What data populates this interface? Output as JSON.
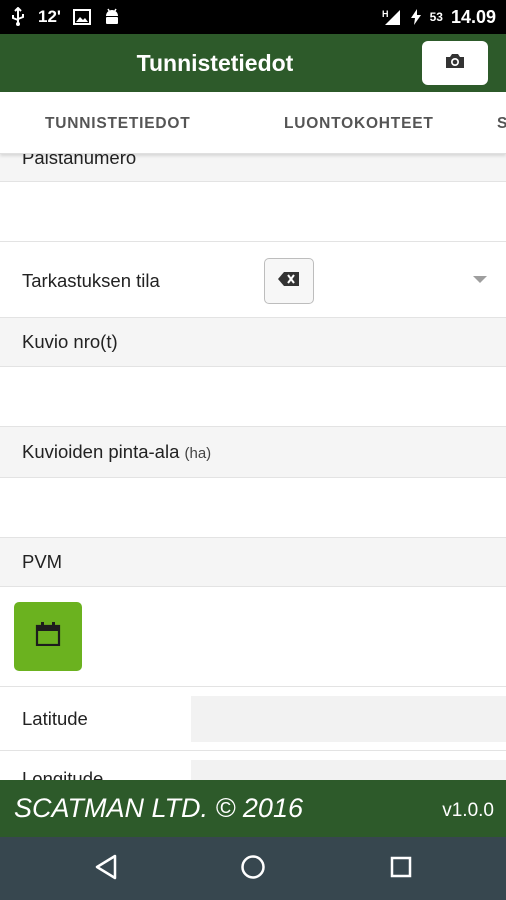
{
  "status_bar": {
    "usb_icon": "usb-icon",
    "temperature": "12'",
    "image_icon": "image-icon",
    "android_icon": "android-icon",
    "signal_label": "H",
    "battery": "53",
    "time": "14.09"
  },
  "app_bar": {
    "title": "Tunnistetiedot",
    "camera_icon": "camera-icon"
  },
  "tabs": [
    {
      "label": "TUNNISTETIEDOT"
    },
    {
      "label": "LUONTOKOHTEET"
    },
    {
      "label": "S"
    }
  ],
  "form": {
    "palstanumero_label": "Palstanumero",
    "palstanumero_value": "",
    "tarkastuksen_tila_label": "Tarkastuksen tila",
    "tarkastuksen_tila_value": "",
    "kuvio_label": "Kuvio nro(t)",
    "kuvio_value": "",
    "pinta_ala_label": "Kuvioiden pinta-ala",
    "pinta_ala_unit": "(ha)",
    "pinta_ala_value": "",
    "pvm_label": "PVM",
    "latitude_label": "Latitude",
    "latitude_value": "",
    "longitude_label": "Longitude",
    "longitude_value": ""
  },
  "footer": {
    "copyright": "SCATMAN LTD. © 2016",
    "version": "v1.0.0"
  },
  "colors": {
    "primary": "#2d5a2a",
    "accent": "#6bb21f",
    "navbar": "#37474f"
  }
}
